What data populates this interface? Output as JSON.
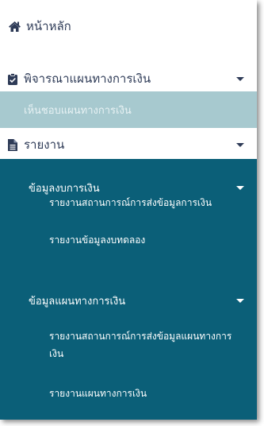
{
  "colors": {
    "text_dark": "#2e3b57",
    "active_bg": "#a7c9cf",
    "submenu_bg": "#0b5f78",
    "submenu_text": "#ffffff"
  },
  "menu": {
    "home": {
      "label": "หน้าหลัก",
      "icon": "home-icon"
    },
    "plan": {
      "label": "พิจารณาแผนทางการเงิน",
      "icon": "clipboard-check-icon",
      "sub_item": "เห็นชอบแผนทางการเงิน"
    },
    "report": {
      "label": "รายงาน",
      "icon": "file-icon",
      "groups": [
        {
          "label": "ข้อมูลงบการเงิน",
          "items": [
            "รายงานสถานการณ์การส่งข้อมูลการเงิน",
            "รายงานข้อมูลงบทดลอง"
          ]
        },
        {
          "label": "ข้อมูลแผนทางการเงิน",
          "items": [
            "รายงานสถานการณ์การส่งข้อมูลแผนทางการเงิน",
            "รายงานแผนทางการเงิน"
          ]
        }
      ]
    }
  }
}
